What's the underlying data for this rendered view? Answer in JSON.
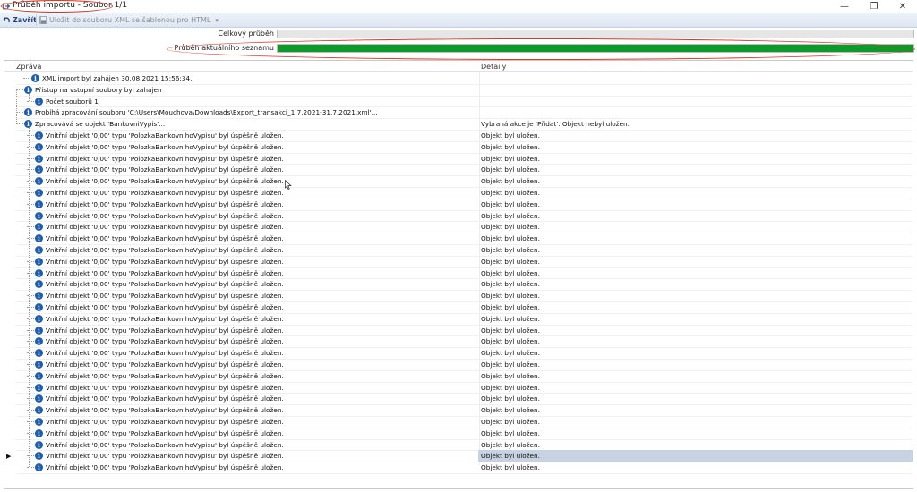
{
  "window": {
    "title": "Průběh importu - Soubor 1/1",
    "minimize": "—",
    "maximize": "❐",
    "close": "✕"
  },
  "toolbar": {
    "close_label": "Zavřít",
    "save_label": "Uložit do souboru XML se šablonou pro HTML"
  },
  "progress": {
    "overall_label": "Celkový průběh",
    "overall_fraction": 0.0,
    "current_label": "Průběh aktuálního seznamu",
    "current_fraction": 1.0,
    "bar_color": "#0e9a2a"
  },
  "grid": {
    "col_message": "Zpráva",
    "col_detail": "Detaily",
    "accent_color": "#1a5fb4",
    "selected_row_color": "#c7d3e2",
    "rows": [
      {
        "message": "XML import byl zahájen 30.08.2021 15:56:34.",
        "detail": "",
        "level": 1
      },
      {
        "message": "Přístup na vstupní soubory byl zahájen",
        "detail": "",
        "level": 1
      },
      {
        "message": "Počet souborů 1",
        "detail": "",
        "level": 2
      },
      {
        "message": "Probíhá zpracování souboru 'C:\\Users\\Mouchova\\Downloads\\Export_transakci_1.7.2021-31.7.2021.xml'...",
        "detail": "",
        "level": 0
      },
      {
        "message": "Zpracovává se objekt 'BankovniVypis'...",
        "detail": "Vybraná akce je 'Přidat'. Objekt nebyl uložen.",
        "level": 1
      },
      {
        "message": "Vnitřní objekt '0,00' typu 'PolozkaBankovnihoVypisu' byl úspěšně uložen.",
        "detail": "Objekt byl uložen.",
        "level": 2
      },
      {
        "message": "Vnitřní objekt '0,00' typu 'PolozkaBankovnihoVypisu' byl úspěšně uložen.",
        "detail": "Objekt byl uložen.",
        "level": 2
      },
      {
        "message": "Vnitřní objekt '0,00' typu 'PolozkaBankovnihoVypisu' byl úspěšně uložen.",
        "detail": "Objekt byl uložen.",
        "level": 2
      },
      {
        "message": "Vnitřní objekt '0,00' typu 'PolozkaBankovnihoVypisu' byl úspěšně uložen.",
        "detail": "Objekt byl uložen.",
        "level": 2
      },
      {
        "message": "Vnitřní objekt '0,00' typu 'PolozkaBankovnihoVypisu' byl úspěšně uložen.",
        "detail": "Objekt byl uložen.",
        "level": 2
      },
      {
        "message": "Vnitřní objekt '0,00' typu 'PolozkaBankovnihoVypisu' byl úspěšně uložen.",
        "detail": "Objekt byl uložen.",
        "level": 2
      },
      {
        "message": "Vnitřní objekt '0,00' typu 'PolozkaBankovnihoVypisu' byl úspěšně uložen.",
        "detail": "Objekt byl uložen.",
        "level": 2
      },
      {
        "message": "Vnitřní objekt '0,00' typu 'PolozkaBankovnihoVypisu' byl úspěšně uložen.",
        "detail": "Objekt byl uložen.",
        "level": 2
      },
      {
        "message": "Vnitřní objekt '0,00' typu 'PolozkaBankovnihoVypisu' byl úspěšně uložen.",
        "detail": "Objekt byl uložen.",
        "level": 2
      },
      {
        "message": "Vnitřní objekt '0,00' typu 'PolozkaBankovnihoVypisu' byl úspěšně uložen.",
        "detail": "Objekt byl uložen.",
        "level": 2
      },
      {
        "message": "Vnitřní objekt '0,00' typu 'PolozkaBankovnihoVypisu' byl úspěšně uložen.",
        "detail": "Objekt byl uložen.",
        "level": 2
      },
      {
        "message": "Vnitřní objekt '0,00' typu 'PolozkaBankovnihoVypisu' byl úspěšně uložen.",
        "detail": "Objekt byl uložen.",
        "level": 2
      },
      {
        "message": "Vnitřní objekt '0,00' typu 'PolozkaBankovnihoVypisu' byl úspěšně uložen.",
        "detail": "Objekt byl uložen.",
        "level": 2
      },
      {
        "message": "Vnitřní objekt '0,00' typu 'PolozkaBankovnihoVypisu' byl úspěšně uložen.",
        "detail": "Objekt byl uložen.",
        "level": 2
      },
      {
        "message": "Vnitřní objekt '0,00' typu 'PolozkaBankovnihoVypisu' byl úspěšně uložen.",
        "detail": "Objekt byl uložen.",
        "level": 2
      },
      {
        "message": "Vnitřní objekt '0,00' typu 'PolozkaBankovnihoVypisu' byl úspěšně uložen.",
        "detail": "Objekt byl uložen.",
        "level": 2
      },
      {
        "message": "Vnitřní objekt '0,00' typu 'PolozkaBankovnihoVypisu' byl úspěšně uložen.",
        "detail": "Objekt byl uložen.",
        "level": 2
      },
      {
        "message": "Vnitřní objekt '0,00' typu 'PolozkaBankovnihoVypisu' byl úspěšně uložen.",
        "detail": "Objekt byl uložen.",
        "level": 2
      },
      {
        "message": "Vnitřní objekt '0,00' typu 'PolozkaBankovnihoVypisu' byl úspěšně uložen.",
        "detail": "Objekt byl uložen.",
        "level": 2
      },
      {
        "message": "Vnitřní objekt '0,00' typu 'PolozkaBankovnihoVypisu' byl úspěšně uložen.",
        "detail": "Objekt byl uložen.",
        "level": 2
      },
      {
        "message": "Vnitřní objekt '0,00' typu 'PolozkaBankovnihoVypisu' byl úspěšně uložen.",
        "detail": "Objekt byl uložen.",
        "level": 2
      },
      {
        "message": "Vnitřní objekt '0,00' typu 'PolozkaBankovnihoVypisu' byl úspěšně uložen.",
        "detail": "Objekt byl uložen.",
        "level": 2
      },
      {
        "message": "Vnitřní objekt '0,00' typu 'PolozkaBankovnihoVypisu' byl úspěšně uložen.",
        "detail": "Objekt byl uložen.",
        "level": 2
      },
      {
        "message": "Vnitřní objekt '0,00' typu 'PolozkaBankovnihoVypisu' byl úspěšně uložen.",
        "detail": "Objekt byl uložen.",
        "level": 2
      },
      {
        "message": "Vnitřní objekt '0,00' typu 'PolozkaBankovnihoVypisu' byl úspěšně uložen.",
        "detail": "Objekt byl uložen.",
        "level": 2
      },
      {
        "message": "Vnitřní objekt '0,00' typu 'PolozkaBankovnihoVypisu' byl úspěšně uložen.",
        "detail": "Objekt byl uložen.",
        "level": 2
      },
      {
        "message": "Vnitřní objekt '0,00' typu 'PolozkaBankovnihoVypisu' byl úspěšně uložen.",
        "detail": "Objekt byl uložen.",
        "level": 2
      },
      {
        "message": "Vnitřní objekt '0,00' typu 'PolozkaBankovnihoVypisu' byl úspěšně uložen.",
        "detail": "Objekt byl uložen.",
        "level": 2
      },
      {
        "message": "Vnitřní objekt '0,00' typu 'PolozkaBankovnihoVypisu' byl úspěšně uložen.",
        "detail": "Objekt byl uložen.",
        "level": 2,
        "selected": true
      },
      {
        "message": "Vnitřní objekt '0,00' typu 'PolozkaBankovnihoVypisu' byl úspěšně uložen.",
        "detail": "Objekt byl uložen.",
        "level": 2
      }
    ]
  }
}
